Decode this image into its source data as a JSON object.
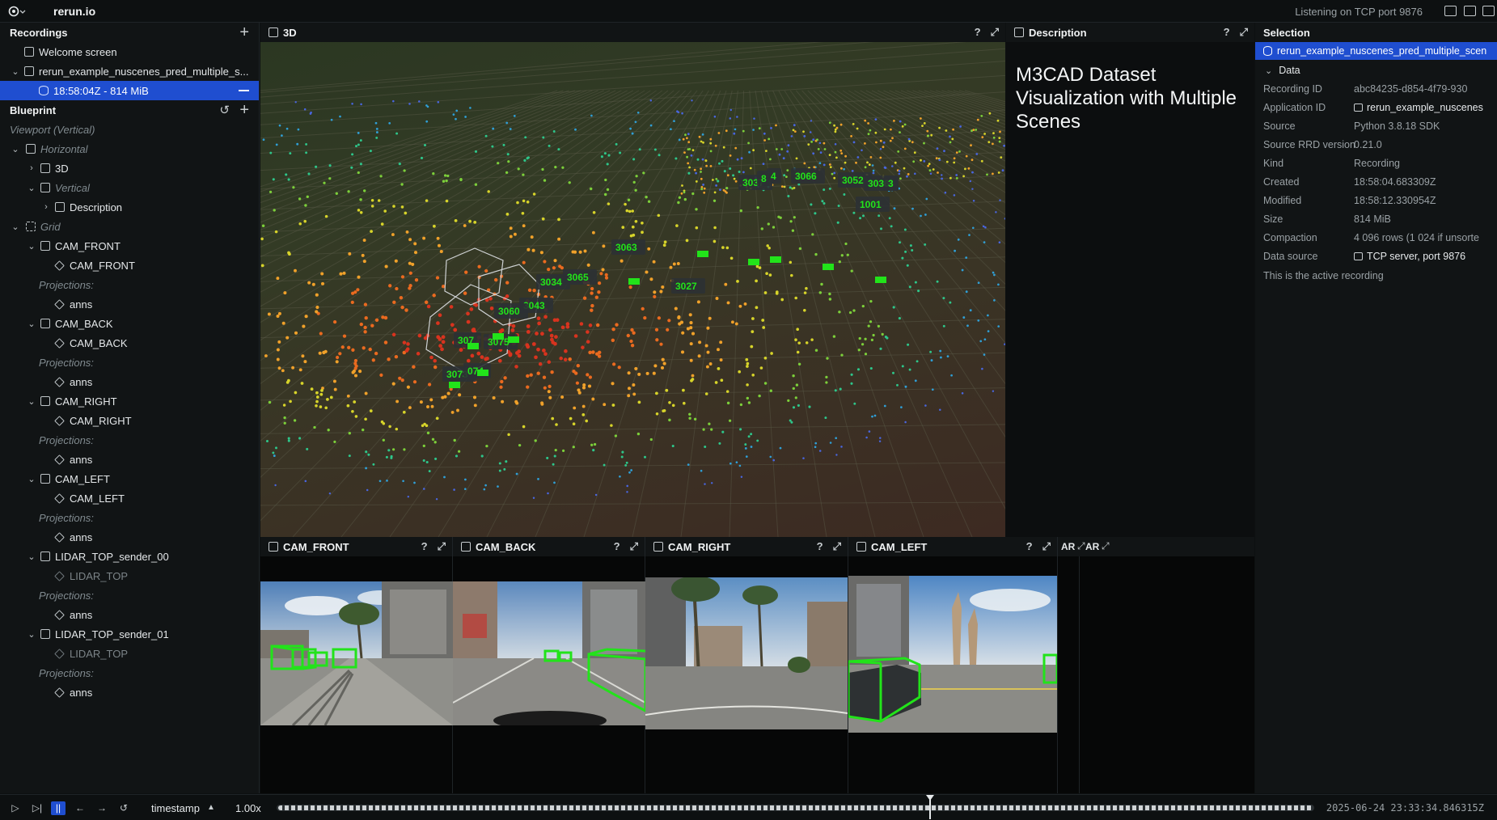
{
  "topbar": {
    "app_title": "rerun.io",
    "status": "Listening on TCP port 9876"
  },
  "recordings": {
    "header": "Recordings",
    "items": [
      {
        "label": "Welcome screen"
      },
      {
        "label": "rerun_example_nuscenes_pred_multiple_s..."
      },
      {
        "label": "18:58:04Z - 814 MiB"
      }
    ]
  },
  "blueprint": {
    "header": "Blueprint",
    "tree": [
      {
        "label": "Viewport (Vertical)"
      },
      {
        "label": "Horizontal"
      },
      {
        "label": "3D"
      },
      {
        "label": "Vertical"
      },
      {
        "label": "Description"
      },
      {
        "label": "Grid"
      },
      {
        "label": "CAM_FRONT"
      },
      {
        "label": "CAM_FRONT"
      },
      {
        "label": "Projections:"
      },
      {
        "label": "anns"
      },
      {
        "label": "CAM_BACK"
      },
      {
        "label": "CAM_BACK"
      },
      {
        "label": "Projections:"
      },
      {
        "label": "anns"
      },
      {
        "label": "CAM_RIGHT"
      },
      {
        "label": "CAM_RIGHT"
      },
      {
        "label": "Projections:"
      },
      {
        "label": "anns"
      },
      {
        "label": "CAM_LEFT"
      },
      {
        "label": "CAM_LEFT"
      },
      {
        "label": "Projections:"
      },
      {
        "label": "anns"
      },
      {
        "label": "LIDAR_TOP_sender_00"
      },
      {
        "label": "LIDAR_TOP"
      },
      {
        "label": "Projections:"
      },
      {
        "label": "anns"
      },
      {
        "label": "LIDAR_TOP_sender_01"
      },
      {
        "label": "LIDAR_TOP"
      },
      {
        "label": "Projections:"
      },
      {
        "label": "anns"
      }
    ]
  },
  "view3d": {
    "title": "3D",
    "help": "?",
    "labels": [
      "3037",
      "8",
      "4",
      "3066",
      "3052",
      "3036",
      "3",
      "1001",
      "3063",
      "3034",
      "3065",
      "3027",
      "3043",
      "3060",
      "307",
      "3075",
      "3073",
      "074"
    ]
  },
  "description": {
    "header": "Description",
    "help": "?",
    "title": "M3CAD Dataset Visualization with Multiple Scenes"
  },
  "selection": {
    "header": "Selection",
    "item": "rerun_example_nuscenes_pred_multiple_scen",
    "section": "Data",
    "rows": [
      {
        "key": "Recording ID",
        "value": "abc84235-d854-4f79-930"
      },
      {
        "key": "Application ID",
        "value": "rerun_example_nuscenes"
      },
      {
        "key": "Source",
        "value": "Python 3.8.18 SDK"
      },
      {
        "key": "Source RRD version",
        "value": "0.21.0"
      },
      {
        "key": "Kind",
        "value": "Recording"
      },
      {
        "key": "Created",
        "value": "18:58:04.683309Z"
      },
      {
        "key": "Modified",
        "value": "18:58:12.330954Z"
      },
      {
        "key": "Size",
        "value": "814 MiB"
      },
      {
        "key": "Compaction",
        "value": "4 096 rows (1 024 if unsorte"
      },
      {
        "key": "Data source",
        "value": "TCP server, port 9876"
      }
    ],
    "note": "This is the active recording"
  },
  "cameras": [
    {
      "title": "CAM_FRONT",
      "help": "?"
    },
    {
      "title": "CAM_BACK",
      "help": "?"
    },
    {
      "title": "CAM_RIGHT",
      "help": "?"
    },
    {
      "title": "CAM_LEFT",
      "help": "?"
    }
  ],
  "overflow_tabs": [
    "AR",
    "AR"
  ],
  "timeline": {
    "timeline_name": "timestamp",
    "speed": "1.00x",
    "current_time": "2025-06-24 23:33:34.846315Z",
    "cursor_fraction": 0.63
  },
  "colors": {
    "accent": "#1f4ed0",
    "bbox": "#22e31a",
    "label_text": "#22e31a"
  }
}
